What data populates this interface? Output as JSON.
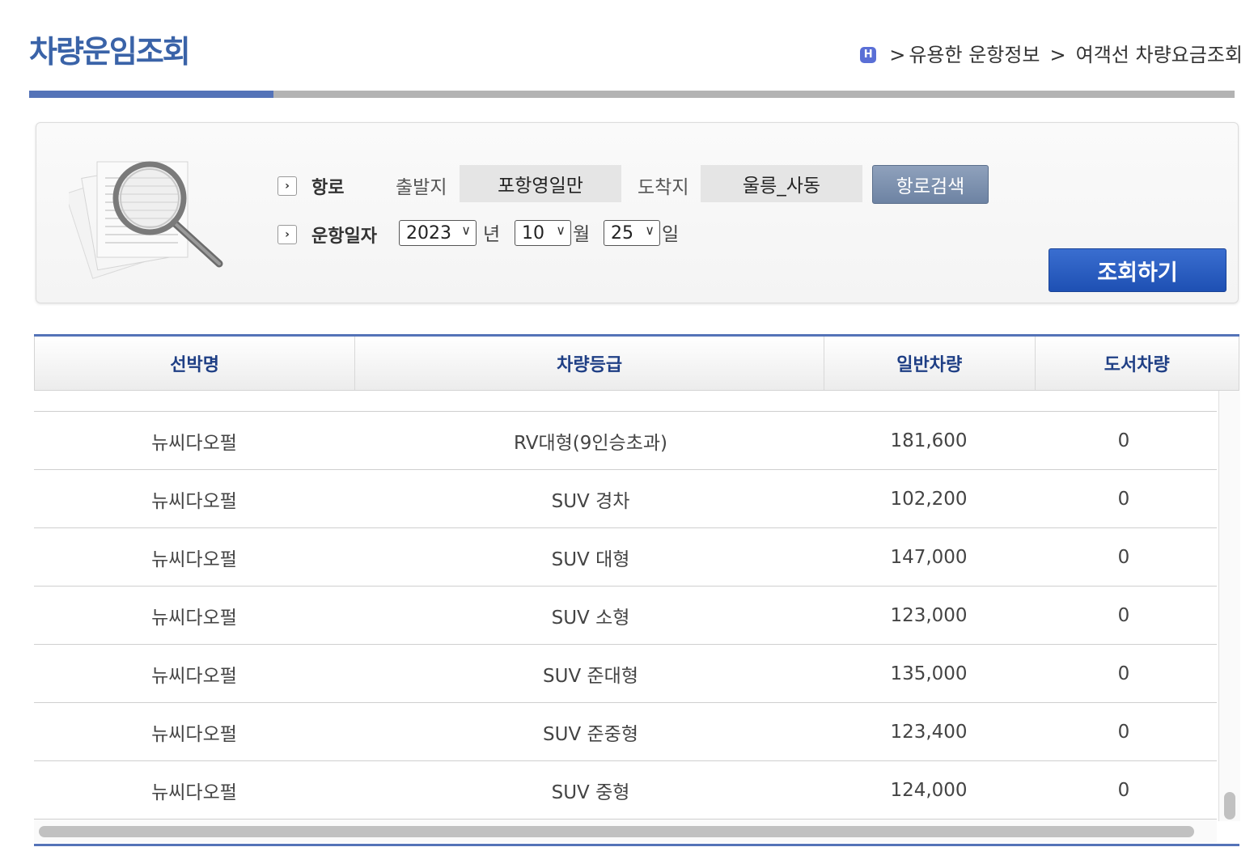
{
  "page": {
    "title": "차량운임조회",
    "breadcrumb": {
      "home_icon_text": "H",
      "sep1": ">",
      "section": "유용한 운항정보",
      "sep2": ">",
      "current": "여객선 차량요금조회"
    }
  },
  "search": {
    "route_label": "항로",
    "departure_label": "출발지",
    "departure_value": "포항영일만",
    "arrival_label": "도착지",
    "arrival_value": "울릉_사동",
    "route_search_button": "항로검색",
    "date_label": "운항일자",
    "year_value": "2023",
    "year_unit": "년",
    "month_value": "10",
    "month_unit": "월",
    "day_value": "25",
    "day_unit": "일",
    "query_button": "조회하기"
  },
  "table": {
    "headers": [
      "선박명",
      "차량등급",
      "일반차량",
      "도서차량"
    ],
    "rows": [
      {
        "ship": "뉴씨다오펄",
        "grade": "RV대형(9인승초과)",
        "general": "181,600",
        "island": "0"
      },
      {
        "ship": "뉴씨다오펄",
        "grade": "SUV 경차",
        "general": "102,200",
        "island": "0"
      },
      {
        "ship": "뉴씨다오펄",
        "grade": "SUV 대형",
        "general": "147,000",
        "island": "0"
      },
      {
        "ship": "뉴씨다오펄",
        "grade": "SUV 소형",
        "general": "123,000",
        "island": "0"
      },
      {
        "ship": "뉴씨다오펄",
        "grade": "SUV 준대형",
        "general": "135,000",
        "island": "0"
      },
      {
        "ship": "뉴씨다오펄",
        "grade": "SUV 준중형",
        "general": "123,400",
        "island": "0"
      },
      {
        "ship": "뉴씨다오펄",
        "grade": "SUV 중형",
        "general": "124,000",
        "island": "0"
      }
    ]
  },
  "colors": {
    "accent_blue": "#5473b8",
    "title_blue": "#3a63a8",
    "header_text": "#1f3f85",
    "query_button": "#1e50b3",
    "route_button": "#7a8fae"
  },
  "icons": {
    "home": "home-badge-icon",
    "panel": "magnifier-document-icon",
    "row_marker": "chevron-right-icon",
    "dropdown": "chevron-down-icon"
  }
}
